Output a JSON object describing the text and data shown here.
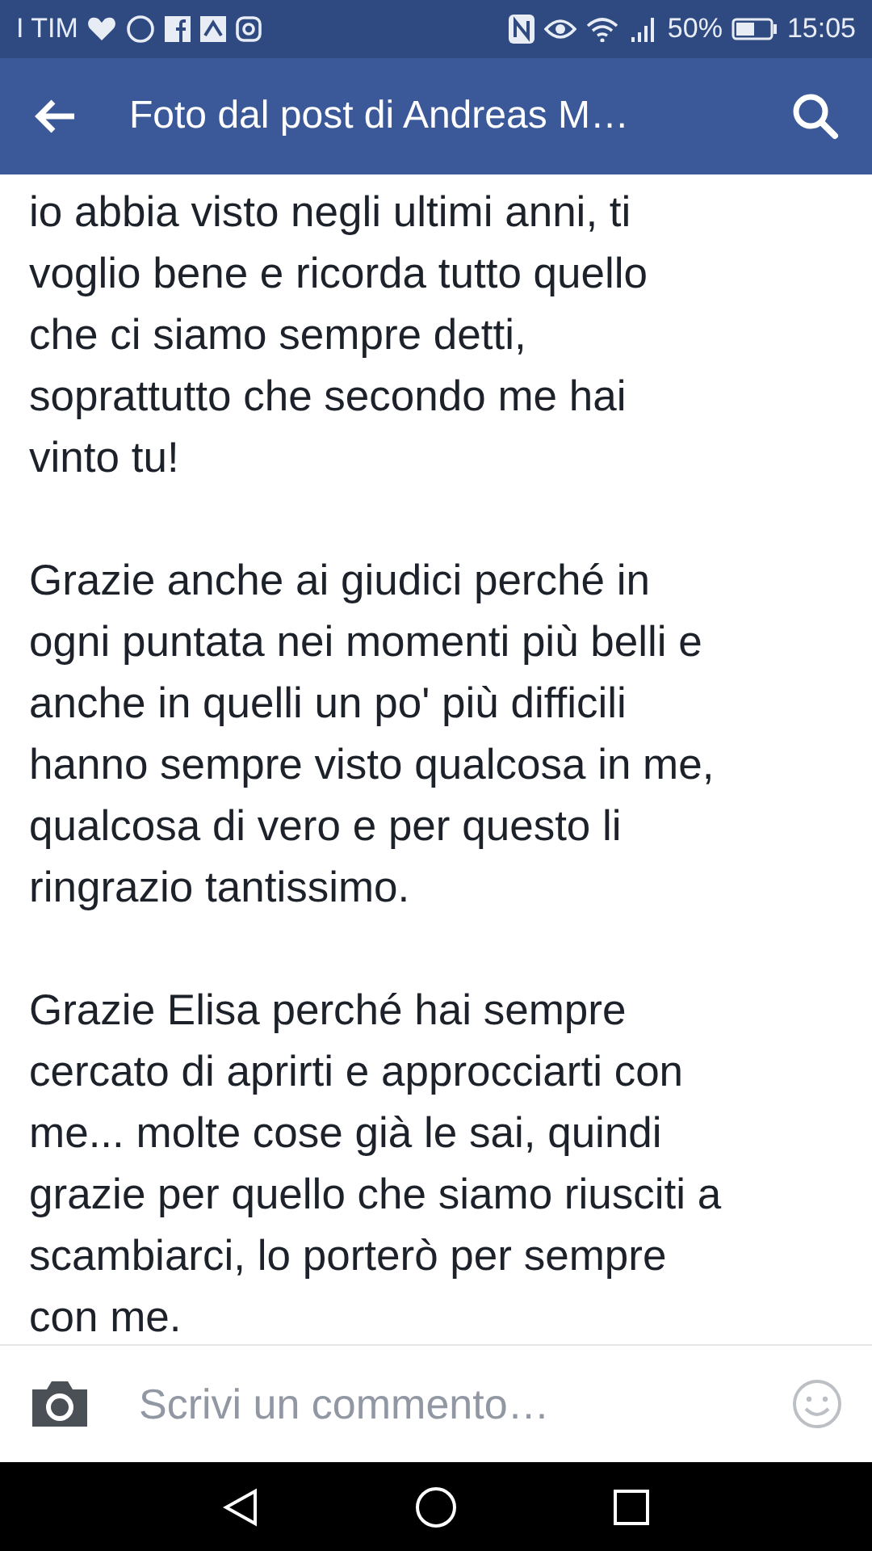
{
  "status_bar": {
    "carrier": "I TIM",
    "battery": "50%",
    "time": "15:05"
  },
  "app_bar": {
    "title": "Foto dal post di Andreas M…"
  },
  "post": {
    "paragraphs": [
      [
        "io abbia visto negli ultimi anni, ti",
        "voglio bene e ricorda tutto quello",
        "che ci siamo sempre detti,",
        "soprattutto che secondo me hai",
        "vinto tu!"
      ],
      [
        "Grazie anche ai giudici perché in",
        "ogni puntata nei momenti più belli e",
        "anche in quelli un po' più difficili",
        "hanno sempre visto qualcosa in me,",
        "qualcosa di vero e per questo li",
        "ringrazio tantissimo."
      ],
      [
        "Grazie Elisa perché hai sempre",
        "cercato di aprirti e approcciarti con",
        "me... molte cose già le sai, quindi",
        "grazie per quello che siamo riusciti a",
        "scambiarci, lo porterò per sempre",
        "con me."
      ]
    ]
  },
  "comment_bar": {
    "placeholder": "Scrivi un commento…"
  }
}
